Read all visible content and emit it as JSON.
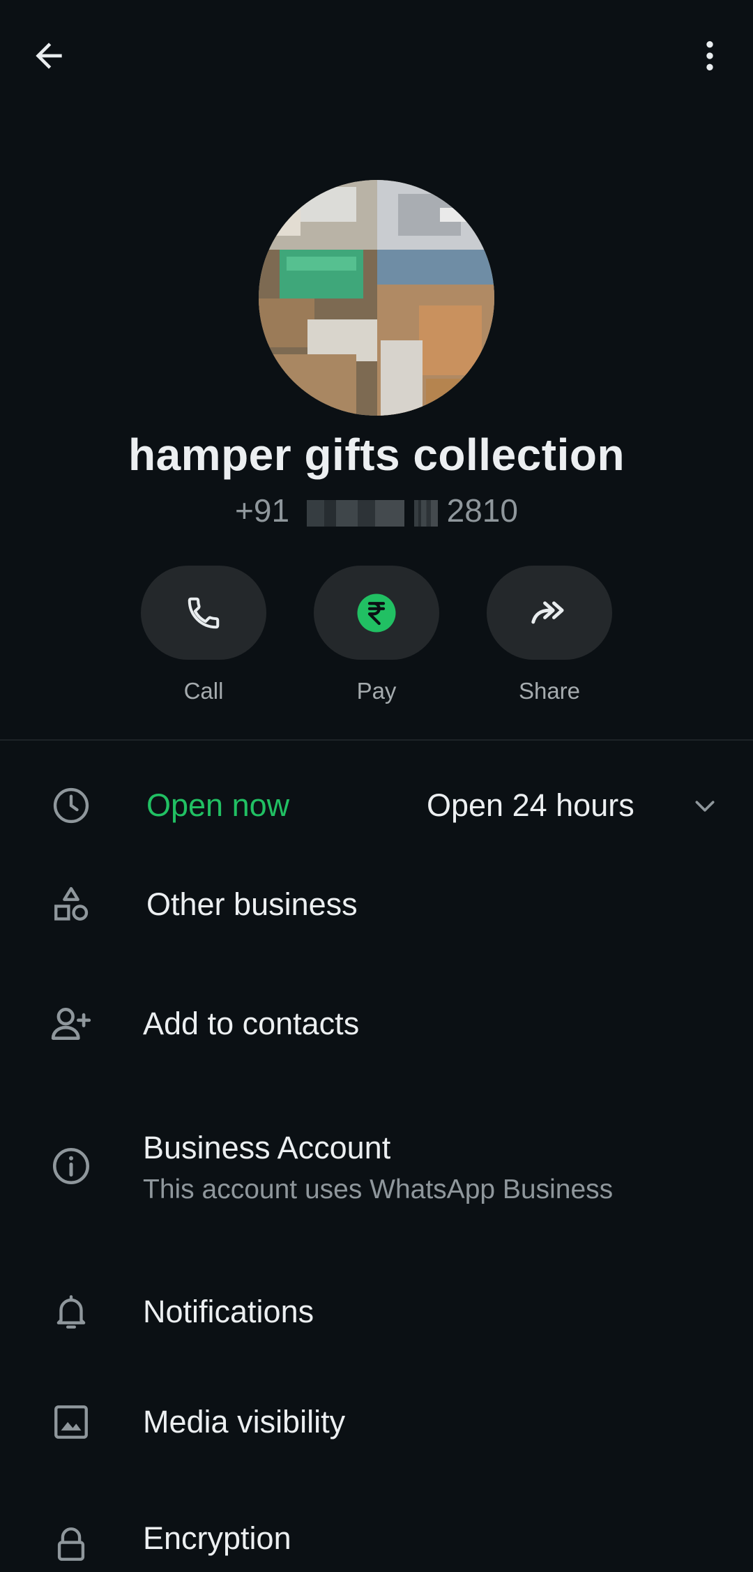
{
  "header": {
    "back_icon": "arrow-left-icon",
    "menu_icon": "more-vertical-icon"
  },
  "profile": {
    "name": "hamper gifts collection",
    "phone_prefix": "+91",
    "phone_suffix": "2810",
    "avatar_icon": "profile-photo"
  },
  "actions": [
    {
      "label": "Call",
      "icon": "phone-icon"
    },
    {
      "label": "Pay",
      "icon": "rupee-icon"
    },
    {
      "label": "Share",
      "icon": "share-icon"
    }
  ],
  "info": {
    "hours_status": "Open now",
    "hours_value": "Open 24 hours",
    "category": "Other business",
    "add_contacts": "Add to contacts",
    "business_title": "Business Account",
    "business_sub": "This account uses WhatsApp Business",
    "notifications": "Notifications",
    "media_visibility": "Media visibility",
    "partial_row": "Encryption"
  },
  "colors": {
    "background": "#0b1014",
    "accent_green": "#21c063",
    "pill_bg": "#24282b",
    "text_primary": "#eceff1",
    "text_secondary": "#8f979c"
  }
}
